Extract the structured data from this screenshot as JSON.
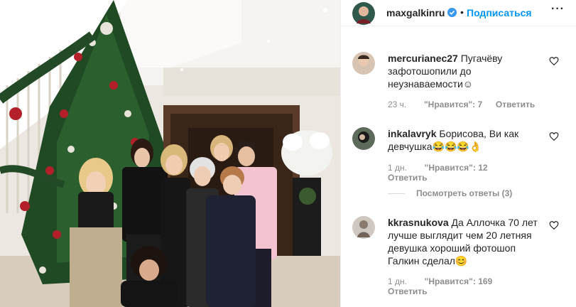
{
  "post": {
    "photo_alt": "group-photo-christmas-tree"
  },
  "header": {
    "username": "maxgalkinru",
    "separator": "•",
    "follow_label": "Подписаться",
    "more_label": "···"
  },
  "comments": [
    {
      "username": "mercurianec27",
      "text": "Пугачёву зафотошопили до неузнаваемости☺",
      "time": "23 ч.",
      "likes": "\"Нравится\": 7",
      "reply": "Ответить"
    },
    {
      "username": "inkalavryk",
      "text": "Борисова, Ви как девчушка😂😂😂👌",
      "time": "1 дн.",
      "likes": "\"Нравится\": 12",
      "reply": "Ответить",
      "view_replies": "Посмотреть ответы (3)"
    },
    {
      "username": "kkrasnukova",
      "text": "Да Аллочка 70 лет лучше выглядит чем 20 летняя девушка хороший фотошоп Галкин сделал😊",
      "time": "1 дн.",
      "likes": "\"Нравится\": 169",
      "reply": "Ответить"
    }
  ],
  "colors": {
    "accent": "#0095f6",
    "verified": "#3897f0",
    "muted": "#8e8e8e"
  }
}
